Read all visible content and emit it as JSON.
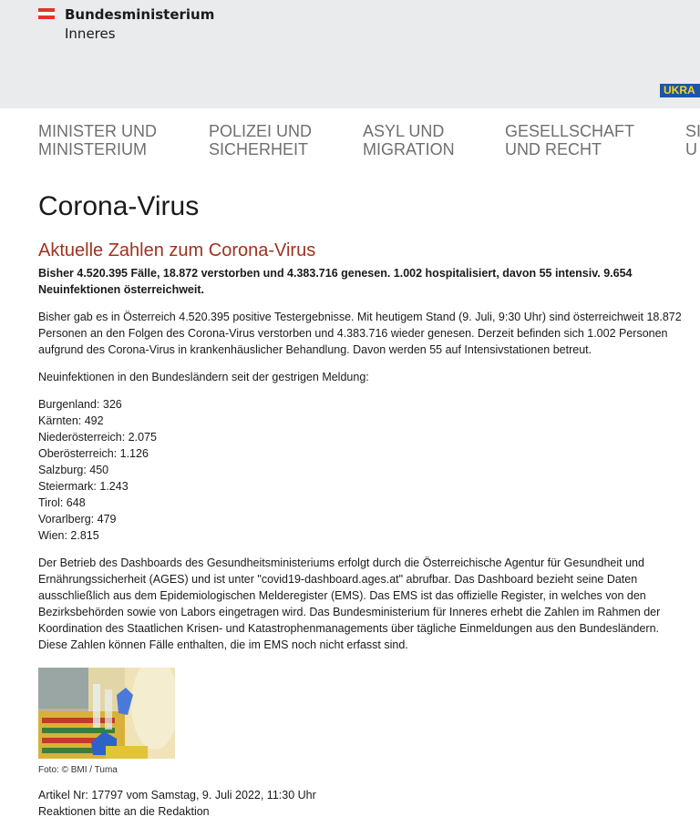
{
  "header": {
    "logo_line1": "Bundesministerium",
    "logo_line2": "Inneres",
    "ukraine_badge": "UKRA",
    "colors": {
      "flag_red": "#e2362a",
      "topbar_bg": "#e9ebed",
      "badge_bg": "#1b57a5",
      "badge_text": "#f7d51d"
    }
  },
  "nav": {
    "items": [
      {
        "label": "MINISTER UND\nMINISTERIUM"
      },
      {
        "label": "POLIZEI UND\nSICHERHEIT"
      },
      {
        "label": "ASYL UND\nMIGRATION"
      },
      {
        "label": "GESELLSCHAFT\nUND RECHT"
      },
      {
        "label": "SI\nU"
      }
    ]
  },
  "article": {
    "title": "Corona-Virus",
    "subtitle": "Aktuelle Zahlen zum Corona-Virus",
    "lead": "Bisher 4.520.395 Fälle, 18.872 verstorben und 4.383.716 genesen. 1.002 hospitalisiert, davon 55 intensiv. 9.654 Neuinfektionen österreichweit.",
    "paragraph1": "Bisher gab es in Österreich 4.520.395 positive Testergebnisse. Mit heutigem Stand (9. Juli, 9:30 Uhr) sind österreichweit 18.872 Personen an den Folgen des Corona-Virus verstorben und 4.383.716 wieder genesen. Derzeit befinden sich 1.002 Personen aufgrund des Corona-Virus in krankenhäuslicher Behandlung. Davon werden 55 auf Intensivstationen betreut.",
    "states_intro": "Neuinfektionen in den Bundesländern seit der gestrigen Meldung:",
    "states": [
      "Burgenland: 326",
      "Kärnten: 492",
      "Niederösterreich: 2.075",
      "Oberösterreich: 1.126",
      "Salzburg: 450",
      "Steiermark: 1.243",
      "Tirol: 648",
      "Vorarlberg: 479",
      "Wien: 2.815"
    ],
    "paragraph2": "Der Betrieb des Dashboards des Gesundheitsministeriums erfolgt durch die Österreichische Agentur für Gesundheit und Ernährungssicherheit (AGES) und ist unter \"covid19-dashboard.ages.at\" abrufbar. Das Dashboard bezieht seine Daten ausschließlich aus dem Epidemiologischen Melderegister (EMS). Das EMS ist das offizielle Register, in welches von den Bezirksbehörden sowie von Labors eingetragen wird. Das Bundesministerium für Inneres erhebt die Zahlen im Rahmen der Koordination des Staatlichen Krisen- und Katastrophenmanagements über tägliche Einmeldungen aus den Bundesländern. Diese Zahlen können Fälle enthalten, die im EMS noch nicht erfasst sind.",
    "photo_caption": "Foto: ©  BMI / Tuma",
    "article_meta": "Artikel Nr: 17797 vom Samstag, 9. Juli 2022, 11:30 Uhr",
    "feedback": "Reaktionen bitte an die Redaktion"
  }
}
